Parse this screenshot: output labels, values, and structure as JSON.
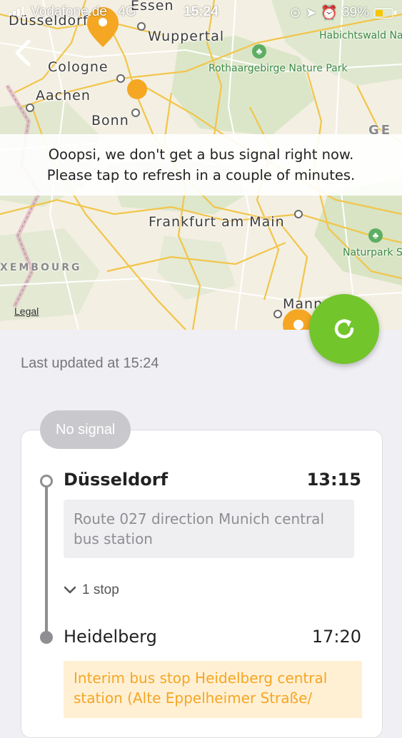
{
  "status_bar": {
    "carrier": "Vodafone.de",
    "network": "4G",
    "time": "15:24",
    "battery": "39%",
    "battery_level": 0.39,
    "icons": [
      "signal-icon",
      "rotation-lock-icon",
      "location-arrow-icon",
      "alarm-icon",
      "battery-icon"
    ]
  },
  "map": {
    "cities": [
      "Düsseldorf",
      "Essen",
      "Wuppertal",
      "Cologne",
      "Aachen",
      "Bonn",
      "Frankfurt am Main",
      "Mann"
    ],
    "parks": [
      "Habichtswald Nature Park",
      "Rothaargebirge Nature Park",
      "Naturpark Spessart"
    ],
    "regions": [
      "GE",
      "XEMBOURG"
    ],
    "legal": "Legal",
    "marker_color": "#f5a623"
  },
  "alert": {
    "line1": "Ooopsi, we don't get a bus signal right now.",
    "line2": "Please tap to refresh in a couple of minutes."
  },
  "refresh_button": {
    "icon": "refresh-icon",
    "color": "#73c52c"
  },
  "last_updated": "Last updated at 15:24",
  "trip": {
    "badge": "No signal",
    "departure": {
      "city": "Düsseldorf",
      "time": "13:15",
      "info": "Route 027 direction Munich central bus station"
    },
    "intermediate_stops": "1 stop",
    "arrival": {
      "city": "Heidelberg",
      "time": "17:20",
      "info": "Interim bus stop Heidelberg central station (Alte Eppelheimer Straße/"
    }
  }
}
